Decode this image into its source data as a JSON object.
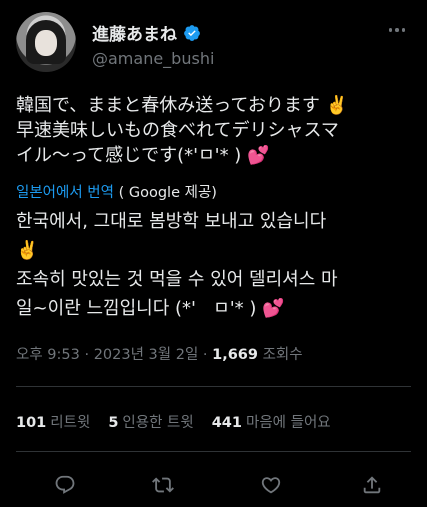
{
  "author": {
    "display_name": "進藤あまね",
    "handle": "@amane_bushi"
  },
  "tweet": {
    "text_original": "韓国で、ままと春休み送っております ✌️\n早速美味しいもの食べれてデリシャスマ\nイル〜って感じです(*'ㅁ'* ) 💕",
    "translate_label": "일본어에서 번역",
    "translate_source": "( Google 제공)",
    "text_translated": "한국에서, 그대로 봄방학 보내고 있습니다\n✌️\n조속히 맛있는 것 먹을 수 있어 델리셔스 마\n일~이란 느낌입니다 (*'   ㅁ'* ) 💕"
  },
  "meta": {
    "time": "오후 9:53",
    "date": "2023년 3월 2일",
    "views_count": "1,669",
    "views_label": "조회수"
  },
  "stats": {
    "retweets_count": "101",
    "retweets_label": "리트윗",
    "quotes_count": "5",
    "quotes_label": "인용한 트윗",
    "likes_count": "441",
    "likes_label": "마음에 들어요"
  },
  "icons": {
    "verified": "verified-badge-icon",
    "more": "more-options-icon",
    "reply": "reply-icon",
    "retweet": "retweet-icon",
    "like": "heart-icon",
    "share": "share-icon"
  },
  "colors": {
    "background": "#000000",
    "text": "#e7e9ea",
    "muted": "#71767b",
    "link": "#1d9bf0",
    "divider": "#2f3336",
    "heart_emoji": "#f4245e"
  }
}
